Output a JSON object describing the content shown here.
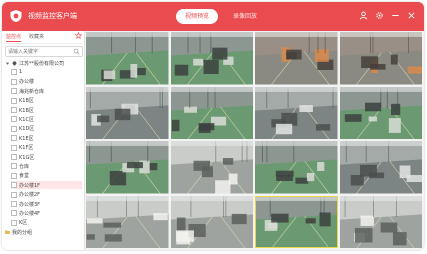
{
  "app": {
    "title": "视频监控客户端",
    "accent_color": "#ea4b4f",
    "logo_icon": "shield-logo"
  },
  "header": {
    "tabs": [
      {
        "label": "视频预览",
        "active": true
      },
      {
        "label": "录像回放",
        "active": false
      }
    ],
    "icons": [
      "user-icon",
      "settings-icon",
      "minimize-icon",
      "close-icon"
    ]
  },
  "sidebar": {
    "tabs": [
      {
        "label": "监控点",
        "active": true
      },
      {
        "label": "收藏夹",
        "active": false
      }
    ],
    "search": {
      "placeholder": "请输入关键字",
      "value": ""
    },
    "tree": [
      {
        "label": "江苏**股份有限公司",
        "kind": "root"
      },
      {
        "label": "1",
        "kind": "group"
      },
      {
        "label": "办公楼",
        "kind": "group"
      },
      {
        "label": "海兆新仓库",
        "kind": "group"
      },
      {
        "label": "K1B区",
        "kind": "group"
      },
      {
        "label": "K1B区",
        "kind": "group"
      },
      {
        "label": "K1C区",
        "kind": "group"
      },
      {
        "label": "K1D区",
        "kind": "group"
      },
      {
        "label": "K1E区",
        "kind": "group"
      },
      {
        "label": "K1F区",
        "kind": "group"
      },
      {
        "label": "K1G区",
        "kind": "group"
      },
      {
        "label": "仓库",
        "kind": "group"
      },
      {
        "label": "食堂",
        "kind": "group"
      },
      {
        "label": "办公楼1F",
        "kind": "group",
        "selected": true
      },
      {
        "label": "办公楼2F",
        "kind": "group"
      },
      {
        "label": "办公楼3F",
        "kind": "group"
      },
      {
        "label": "办公楼4F",
        "kind": "group"
      },
      {
        "label": "K区",
        "kind": "group"
      },
      {
        "label": "我的分组",
        "kind": "folder"
      }
    ]
  },
  "grid": {
    "rows": 4,
    "cols": 4,
    "highlighted_cell": 14,
    "feeds": [
      {
        "scene": "factory-floor-green"
      },
      {
        "scene": "factory-floor-green"
      },
      {
        "scene": "factory-floor-orange"
      },
      {
        "scene": "factory-floor-orange"
      },
      {
        "scene": "factory-floor-grey"
      },
      {
        "scene": "factory-floor-green"
      },
      {
        "scene": "factory-floor-grey"
      },
      {
        "scene": "factory-floor-green"
      },
      {
        "scene": "factory-floor-green"
      },
      {
        "scene": "warehouse-white"
      },
      {
        "scene": "factory-floor-green"
      },
      {
        "scene": "factory-floor-grey"
      },
      {
        "scene": "warehouse-white"
      },
      {
        "scene": "warehouse-white"
      },
      {
        "scene": "factory-floor-green"
      },
      {
        "scene": "warehouse-white"
      }
    ]
  }
}
